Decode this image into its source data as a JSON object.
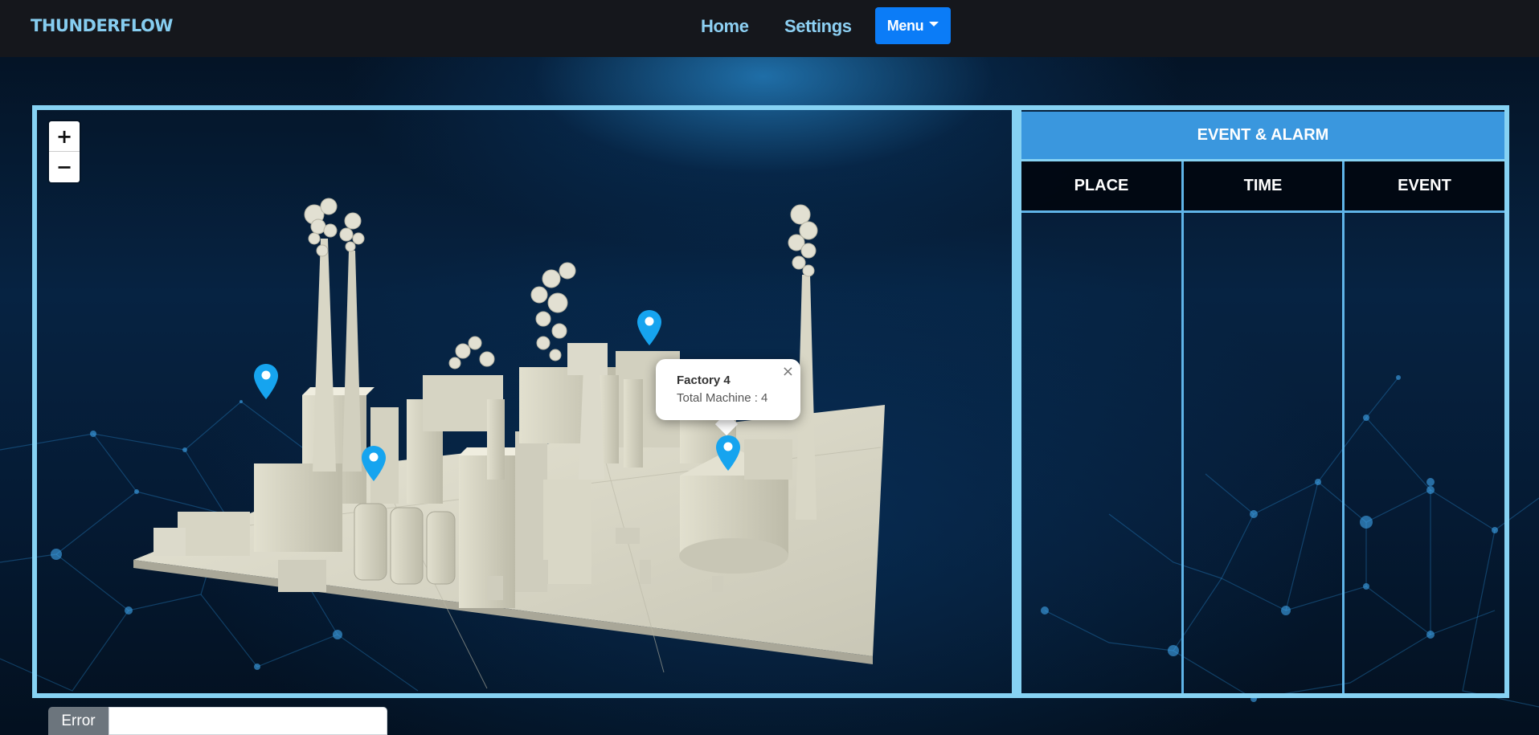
{
  "navbar": {
    "brand": "THUNDERFLOW",
    "links": [
      {
        "label": "Home"
      },
      {
        "label": "Settings"
      }
    ],
    "menu_button": "Menu"
  },
  "map": {
    "zoom_in": "+",
    "zoom_out": "−",
    "markers": [
      "marker",
      "marker",
      "marker",
      "marker"
    ],
    "popup": {
      "title": "Factory 4",
      "text": "Total Machine : 4",
      "close": "×"
    }
  },
  "event_panel": {
    "title": "EVENT & ALARM",
    "columns": [
      "PLACE",
      "TIME",
      "EVENT"
    ],
    "rows": []
  },
  "error_field": {
    "label": "Error",
    "value": ""
  },
  "colors": {
    "brand": "#86cdf0",
    "accent": "#0b7cf7",
    "frame": "#86d2f3",
    "panel_header": "#3a97de",
    "marker": "#16a4ef"
  }
}
